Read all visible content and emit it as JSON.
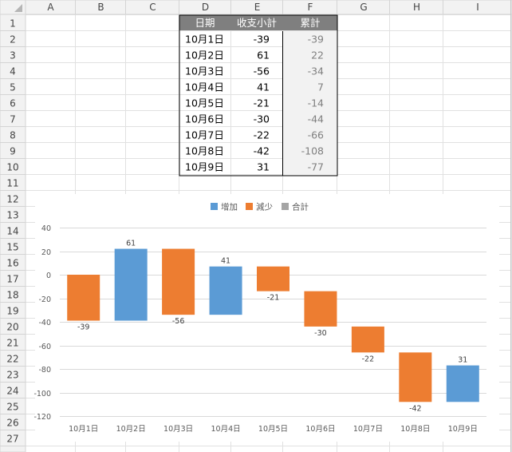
{
  "columns": [
    "A",
    "B",
    "C",
    "D",
    "E",
    "F",
    "G",
    "H",
    "I"
  ],
  "rows": [
    "1",
    "2",
    "3",
    "4",
    "5",
    "6",
    "7",
    "8",
    "9",
    "10",
    "11",
    "12",
    "13",
    "14",
    "15",
    "16",
    "17",
    "18",
    "19",
    "20",
    "21",
    "22",
    "23",
    "24",
    "25",
    "26",
    "27"
  ],
  "table": {
    "headers": [
      "日期",
      "收支小計",
      "累計"
    ],
    "rows": [
      {
        "date": "10月1日",
        "amount": "-39",
        "cumulative": "-39"
      },
      {
        "date": "10月2日",
        "amount": "61",
        "cumulative": "22"
      },
      {
        "date": "10月3日",
        "amount": "-56",
        "cumulative": "-34"
      },
      {
        "date": "10月4日",
        "amount": "41",
        "cumulative": "7"
      },
      {
        "date": "10月5日",
        "amount": "-21",
        "cumulative": "-14"
      },
      {
        "date": "10月6日",
        "amount": "-30",
        "cumulative": "-44"
      },
      {
        "date": "10月7日",
        "amount": "-22",
        "cumulative": "-66"
      },
      {
        "date": "10月8日",
        "amount": "-42",
        "cumulative": "-108"
      },
      {
        "date": "10月9日",
        "amount": "31",
        "cumulative": "-77"
      }
    ]
  },
  "colors": {
    "increase": "#5b9bd5",
    "decrease": "#ed7d31",
    "total": "#a5a5a5",
    "header_bg": "#7f7f7f",
    "cumulative_bg": "#f2f2f2"
  },
  "chart_data": {
    "type": "bar",
    "subtype": "waterfall",
    "categories": [
      "10月1日",
      "10月2日",
      "10月3日",
      "10月4日",
      "10月5日",
      "10月6日",
      "10月7日",
      "10月8日",
      "10月9日"
    ],
    "values": [
      -39,
      61,
      -56,
      41,
      -21,
      -30,
      -22,
      -42,
      31
    ],
    "value_labels": [
      "-39",
      "61",
      "-56",
      "41",
      "-21",
      "-30",
      "-22",
      "-42",
      "31"
    ],
    "legend": [
      "增加",
      "減少",
      "合計"
    ],
    "legend_position": "top",
    "ylim": [
      -120,
      40
    ],
    "yticks": [
      40,
      20,
      0,
      -20,
      -40,
      -60,
      -80,
      -100,
      -120
    ],
    "ytick_labels": [
      "40",
      "20",
      "0",
      "-20",
      "-40",
      "-60",
      "-80",
      "-100",
      "-120"
    ],
    "grid": true
  }
}
